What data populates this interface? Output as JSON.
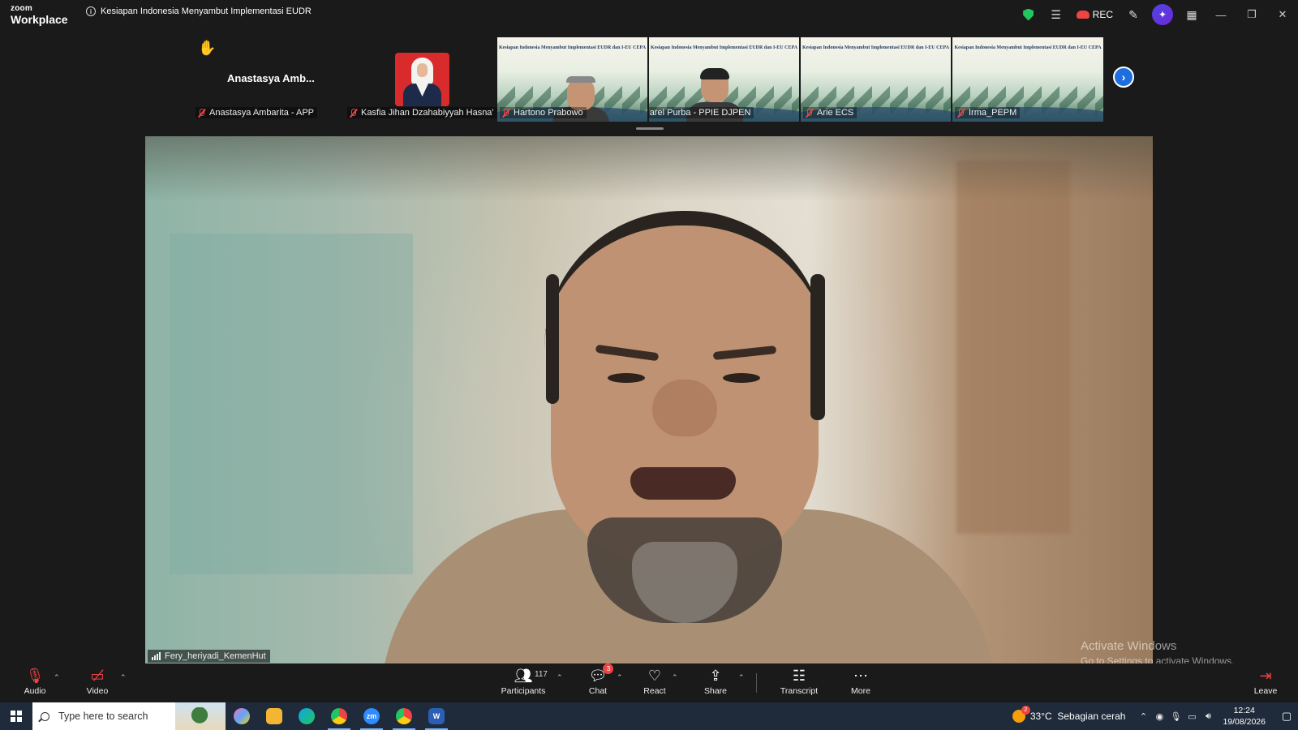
{
  "titlebar": {
    "brand_top": "zoom",
    "brand_bottom": "Workplace",
    "meeting_title": "Kesiapan Indonesia Menyambut Implementasi EUDR",
    "rec_label": "REC"
  },
  "gallery": {
    "tiles": [
      {
        "name": "Anastasya Ambarita - APP",
        "avatar_text": "Anastasya Amb..."
      },
      {
        "name": "Kasfia Jihan Dzahabiyyah Hasna'"
      },
      {
        "name": "Hartono Prabowo"
      },
      {
        "name": "Farel Purba - PPIE DJPEN"
      },
      {
        "name": "Arie ECS"
      },
      {
        "name": "Irma_PEPM"
      }
    ],
    "banner_text": "Kesiapan Indonesia Menyambut Implementasi EUDR dan I-EU CEPA"
  },
  "main": {
    "speaker_name": "Fery_heriyadi_KemenHut"
  },
  "watermark": {
    "line1": "Activate Windows",
    "line2": "Go to Settings to activate Windows."
  },
  "toolbar": {
    "audio_label": "Audio",
    "video_label": "Video",
    "participants_label": "Participants",
    "participants_count": "117",
    "chat_label": "Chat",
    "chat_badge": "3",
    "react_label": "React",
    "share_label": "Share",
    "transcript_label": "Transcript",
    "more_label": "More",
    "leave_label": "Leave"
  },
  "taskbar": {
    "search_placeholder": "Type here to search",
    "weather_temp": "33°C",
    "weather_desc": "Sebagian cerah",
    "weather_badge": "2",
    "time": "12:24",
    "date": "19/08/2026"
  },
  "colors": {
    "accent_blue": "#1d6fe0",
    "muted_red": "#ef4444",
    "secure_green": "#22c55e"
  }
}
